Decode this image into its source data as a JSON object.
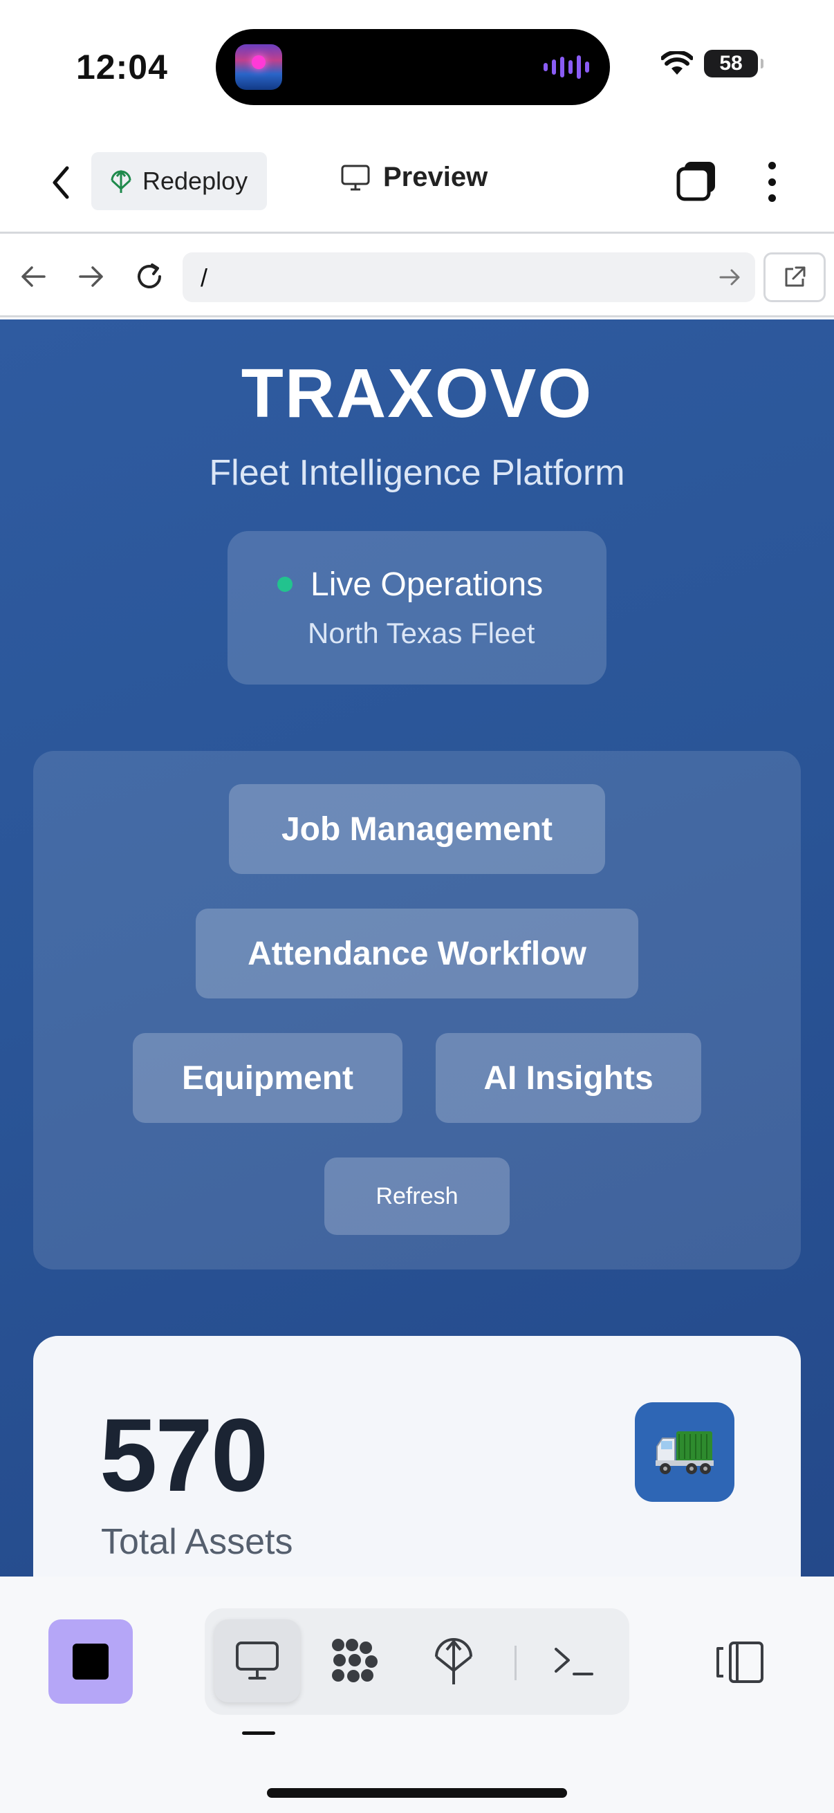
{
  "status_bar": {
    "time": "12:04",
    "battery": "58"
  },
  "app_bar": {
    "redeploy_label": "Redeploy",
    "preview_label": "Preview"
  },
  "url_bar": {
    "url": "/"
  },
  "page": {
    "brand": "TRAXOVO",
    "tagline": "Fleet Intelligence Platform",
    "status": {
      "title": "Live Operations",
      "subtitle": "North Texas Fleet",
      "dot_color": "#22c38e"
    },
    "nav_buttons": [
      "Job Management",
      "Attendance Workflow",
      "Equipment",
      "AI Insights"
    ],
    "refresh_label": "Refresh",
    "stat": {
      "value": "570",
      "label": "Total Assets",
      "icon": "truck-icon"
    }
  },
  "bottom_toolbar": {
    "items": [
      "desktop-icon",
      "apps-icon",
      "deploy-icon",
      "terminal-icon"
    ],
    "active": "desktop-icon"
  },
  "colors": {
    "background_gradient_start": "#2f5ba0",
    "background_gradient_end": "#24498a",
    "stop_button": "#b5a6f7",
    "card_bg": "#f4f6fa"
  }
}
